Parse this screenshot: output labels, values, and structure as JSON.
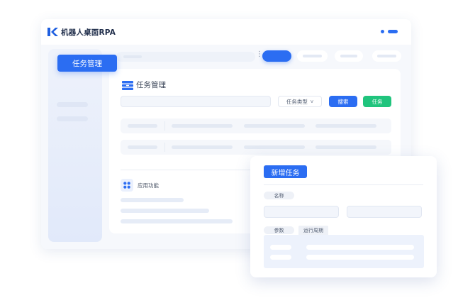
{
  "app": {
    "title": "机器人桌面RPA"
  },
  "colors": {
    "accent": "#2b6df2",
    "success": "#20c47d",
    "sidebar_bg": "#e4ebfa"
  },
  "nav": {
    "active_label": "任务管理"
  },
  "card": {
    "title": "任务管理",
    "title_icon": "folder-stack-icon",
    "filter": {
      "type_select_label": "任务类型",
      "type_select_chevron": "v",
      "search_label": "搜索",
      "task_label": "任务"
    },
    "apps_section": {
      "label": "应用功能",
      "icon": "grid-apps-icon"
    }
  },
  "dialog": {
    "title": "新增任务",
    "name_label": "名称",
    "params_label": "参数",
    "cycle_label": "运行周期"
  }
}
